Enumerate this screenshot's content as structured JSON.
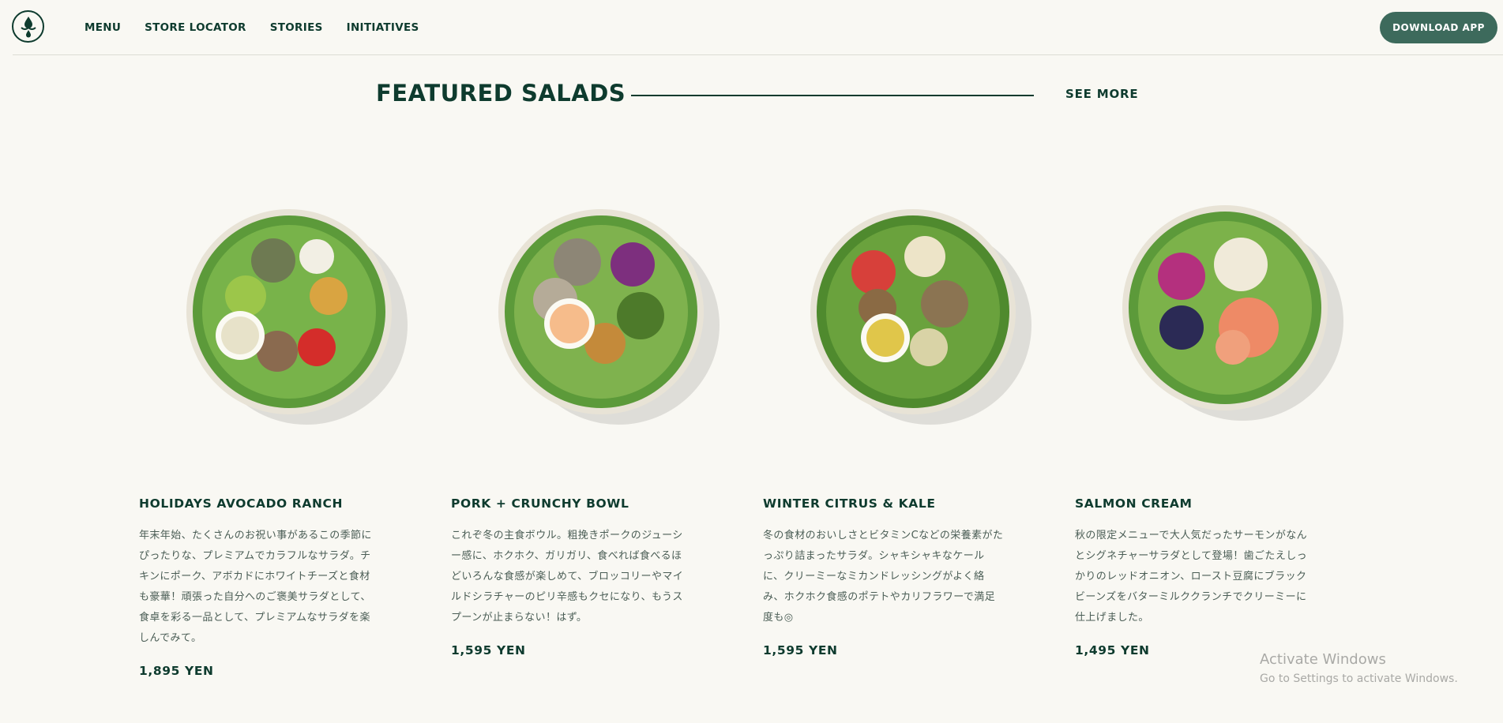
{
  "header": {
    "logo_icon": "drop-logo-icon",
    "nav": [
      "MENU",
      "STORE LOCATOR",
      "STORIES",
      "INITIATIVES"
    ],
    "download_label": "DOWNLOAD  APP",
    "accent_color": "#3d6a5c"
  },
  "section": {
    "title": "FEATURED SALADS",
    "see_more": "SEE  MORE"
  },
  "cards": [
    {
      "name": "HOLIDAYS AVOCADO RANCH",
      "desc": "年末年始、たくさんのお祝い事があるこの季節にぴったりな、プレミアムでカラフルなサラダ。チキンにポーク、アボカドにホワイトチーズと食材も豪華！頑張った自分へのご褒美サラダとして、食卓を彩る一品として、プレミアムなサラダを楽しんでみて。",
      "price": "1,895 YEN",
      "image_icon": "avocado-ranch-salad-bowl-image"
    },
    {
      "name": "PORK + CRUNCHY BOWL",
      "desc": "これぞ冬の主食ボウル。粗挽きポークのジューシー感に、ホクホク、ガリガリ、食べれば食べるほどいろんな食感が楽しめて、ブロッコリーやマイルドシラチャーのピリ辛感もクセになり、もうスプーンが止まらない！はず。",
      "price": "1,595 YEN",
      "image_icon": "pork-crunchy-bowl-image"
    },
    {
      "name": "WINTER CITRUS & KALE",
      "desc": "冬の食材のおいしさとビタミンCなどの栄養素がたっぷり詰まったサラダ。シャキシャキなケールに、クリーミーなミカンドレッシングがよく絡み、ホクホク食感のポテトやカリフラワーで満足度も◎",
      "price": "1,595 YEN",
      "image_icon": "winter-citrus-kale-salad-image"
    },
    {
      "name": "SALMON CREAM",
      "desc": "秋の限定メニューで大人気だったサーモンがなんとシグネチャーサラダとして登場！歯ごたえしっかりのレッドオニオン、ロースト豆腐にブラックビーンズをバターミルククランチでクリーミーに仕上げました。",
      "price": "1,495 YEN",
      "image_icon": "salmon-cream-salad-image"
    }
  ],
  "watermark": {
    "title": "Activate Windows",
    "subtitle": "Go to Settings to activate Windows."
  }
}
